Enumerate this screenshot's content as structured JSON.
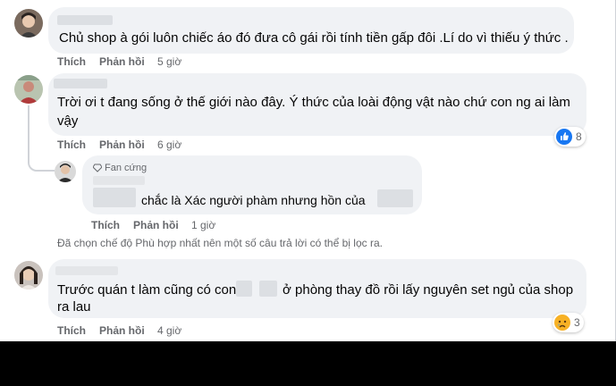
{
  "comments": [
    {
      "text_line1": "Chủ shop à gói luôn chiếc áo đó đưa cô gái rồi tính tiền gấp đôi .Lí do vì thiếu ý thức .",
      "like": "Thích",
      "reply": "Phản hồi",
      "time": "5 giờ"
    },
    {
      "text_line1": "Trời ơi t đang sống ở thế giới nào đây. Ý thức của loài động vật nào chứ con ng ai làm",
      "text_line2": "vậy",
      "like": "Thích",
      "reply": "Phản hồi",
      "time": "6 giờ",
      "reaction": {
        "icon": "like-icon",
        "count": "8",
        "color": "#1877f2"
      }
    },
    {
      "badge": "Fan cứng",
      "text_line1": "chắc là Xác người phàm nhưng hồn của",
      "like": "Thích",
      "reply": "Phản hồi",
      "time": "1 giờ"
    },
    {
      "text_line1": "Trước quán t làm cũng có con",
      "text_line1b": "ở phòng thay đồ rồi lấy nguyên set ngủ của shop",
      "text_line2": "ra lau",
      "like": "Thích",
      "reply": "Phản hồi",
      "time": "4 giờ",
      "reaction": {
        "icon": "sad-icon",
        "count": "3",
        "color": "#f7b125"
      }
    }
  ],
  "filter_notice": "Đã chọn chế độ Phù hợp nhất nên một số câu trả lời có thể bị lọc ra."
}
